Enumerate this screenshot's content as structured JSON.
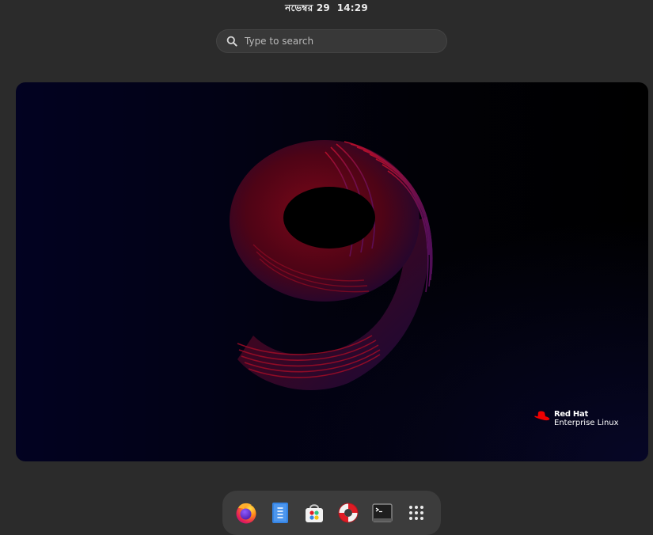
{
  "topbar": {
    "clock": "নভেম্বর 29  14:29"
  },
  "search": {
    "placeholder": "Type to search",
    "icon": "search-icon"
  },
  "workspace": {
    "wallpaper": "Red Hat Enterprise Linux 9 wallpaper",
    "logo": {
      "brand": "Red Hat",
      "product": "Enterprise Linux"
    }
  },
  "dock": {
    "items": [
      {
        "name": "Firefox",
        "icon": "firefox-icon"
      },
      {
        "name": "Text Editor",
        "icon": "text-editor-icon"
      },
      {
        "name": "Software",
        "icon": "software-icon"
      },
      {
        "name": "Help",
        "icon": "help-lifebuoy-icon"
      },
      {
        "name": "Terminal",
        "icon": "terminal-icon"
      },
      {
        "name": "Show Applications",
        "icon": "app-grid-icon"
      }
    ]
  },
  "colors": {
    "background": "#2b2b2b",
    "dock": "#3c3c3c",
    "accent_red": "#ee0000"
  }
}
